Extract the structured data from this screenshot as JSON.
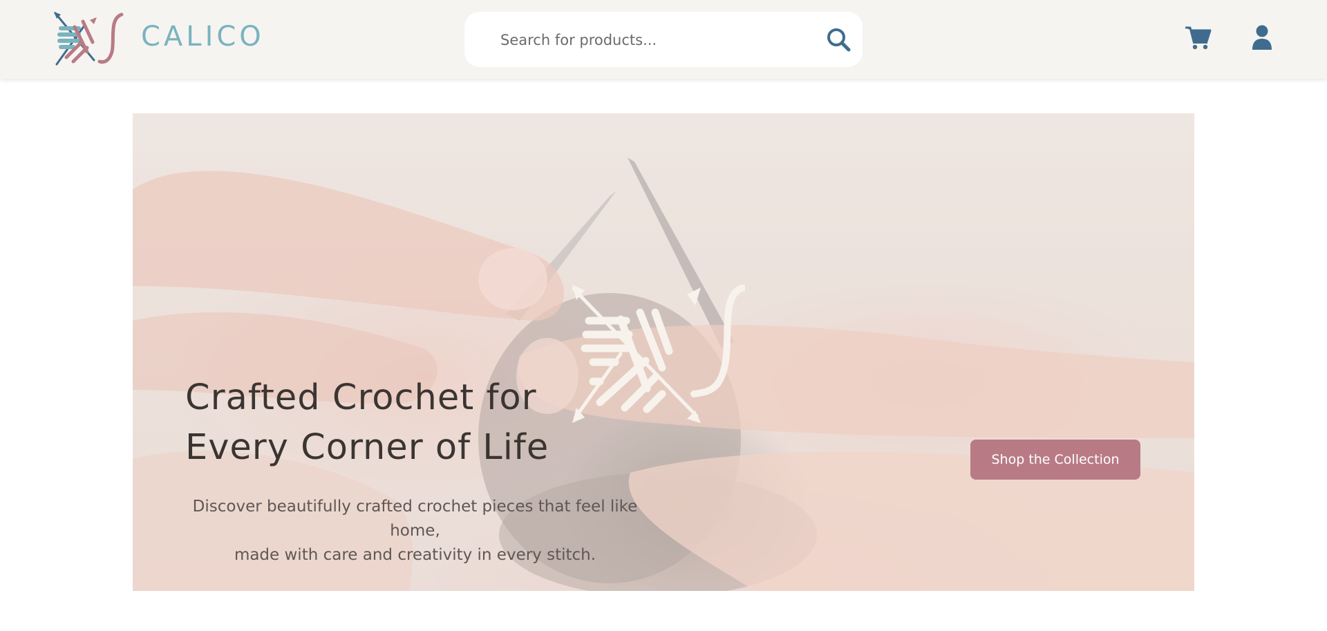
{
  "header": {
    "brand_name": "CALICO",
    "logo_icon": "calico-yarn-needles-logo",
    "search": {
      "placeholder": "Search for products...",
      "value": "",
      "icon": "search-icon"
    },
    "cart_icon": "cart-icon",
    "account_icon": "user-icon"
  },
  "hero": {
    "emblem_icon": "calico-yarn-needles-emblem",
    "title_line1": "Crafted Crochet for",
    "title_line2": "Every Corner of Life",
    "subtitle_line1": "Discover beautifully crafted crochet pieces that feel like home,",
    "subtitle_line2": "made with care and creativity in every stitch.",
    "cta_label": "Shop the Collection"
  },
  "colors": {
    "header_bg": "#f6f4f0",
    "brand_teal": "#79b3bf",
    "brand_rose": "#b87b85",
    "icon_blue": "#3f6c8e",
    "title_text": "#3b3532"
  }
}
